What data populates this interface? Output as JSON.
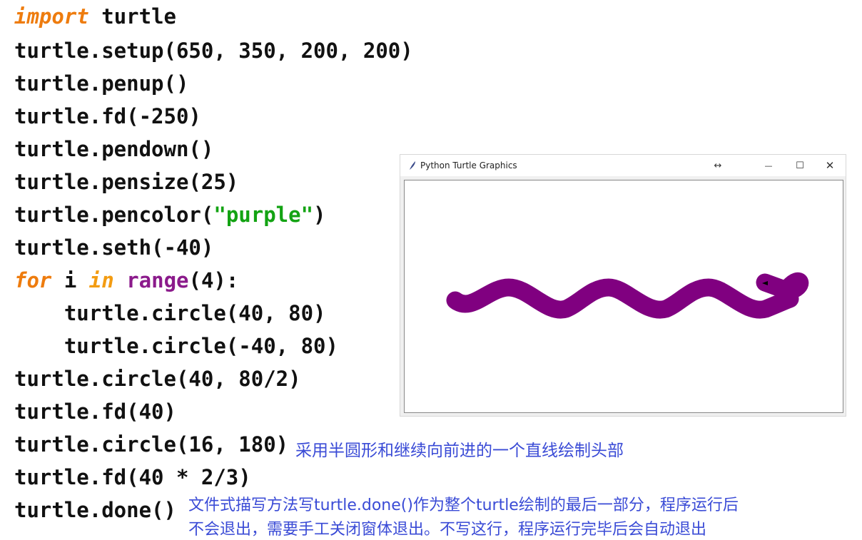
{
  "code": {
    "lines": [
      [
        "import",
        "turtle"
      ],
      [
        "turtle.setup(650, 350, 200, 200)"
      ],
      [
        "turtle.penup()"
      ],
      [
        "turtle.fd(-250)"
      ],
      [
        "turtle.pendown()"
      ],
      [
        "turtle.pensize(25)"
      ],
      [
        "turtle.pencolor(",
        "\"purple\"",
        ")"
      ],
      [
        "turtle.seth(-40)"
      ],
      [
        "for",
        "i",
        "in",
        "range",
        "(4):"
      ],
      [
        "    turtle.circle(40, 80)"
      ],
      [
        "    turtle.circle(-40, 80)"
      ],
      [
        "turtle.circle(40, 80/2)"
      ],
      [
        "turtle.fd(40)"
      ],
      [
        "turtle.circle(16, 180)"
      ],
      [
        "turtle.fd(40 * 2/3)"
      ],
      [
        "turtle.done()"
      ]
    ]
  },
  "notes": {
    "head_note": "采用半圆形和继续向前进的一个直线绘制头部",
    "done_note_line1": "文件式描写方法写turtle.done()作为整个turtle绘制的最后一部分，程序运行后",
    "done_note_line2": "不会退出，需要手工关闭窗体退出。不写这行，程序运行完毕后会自动退出"
  },
  "window": {
    "title": "Python Turtle Graphics",
    "resize_glyph": "↔",
    "minimize_glyph": "—",
    "maximize_glyph": "☐",
    "close_glyph": "✕",
    "snake_color": "#800080"
  },
  "colors": {
    "keyword": "#ee7c0e",
    "builtin": "#8b1a8b",
    "string": "#13a313",
    "note": "#3a4bd6"
  }
}
